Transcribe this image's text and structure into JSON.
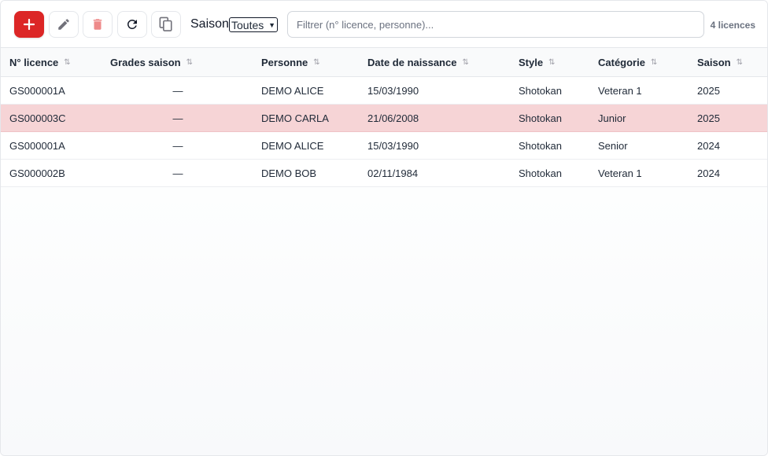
{
  "toolbar": {
    "add_icon": "plus-icon",
    "edit_icon": "pencil-icon",
    "delete_icon": "trash-icon",
    "refresh_icon": "refresh-icon",
    "copy_icon": "copy-icon",
    "saison_label": "Saison",
    "saison_selected": "Toutes",
    "filter_placeholder": "Filtrer (n° licence, personne)...",
    "filter_value": "",
    "count_label": "4 licences"
  },
  "colors": {
    "accent": "#dc2626",
    "selected_row": "#f6d4d6"
  },
  "table": {
    "sort_icon": "sort-icon",
    "sort_glyph": "⇅",
    "columns": [
      "N° licence",
      "Grades saison",
      "Personne",
      "Date de naissance",
      "Style",
      "Catégorie",
      "Saison"
    ],
    "rows": [
      [
        "GS000001A",
        "—",
        "DEMO ALICE",
        "15/03/1990",
        "Shotokan",
        "Veteran 1",
        "2025"
      ],
      [
        "GS000003C",
        "—",
        "DEMO CARLA",
        "21/06/2008",
        "Shotokan",
        "Junior",
        "2025"
      ],
      [
        "GS000001A",
        "—",
        "DEMO ALICE",
        "15/03/1990",
        "Shotokan",
        "Senior",
        "2024"
      ],
      [
        "GS000002B",
        "—",
        "DEMO BOB",
        "02/11/1984",
        "Shotokan",
        "Veteran 1",
        "2024"
      ]
    ],
    "selected_row_index": 1
  }
}
